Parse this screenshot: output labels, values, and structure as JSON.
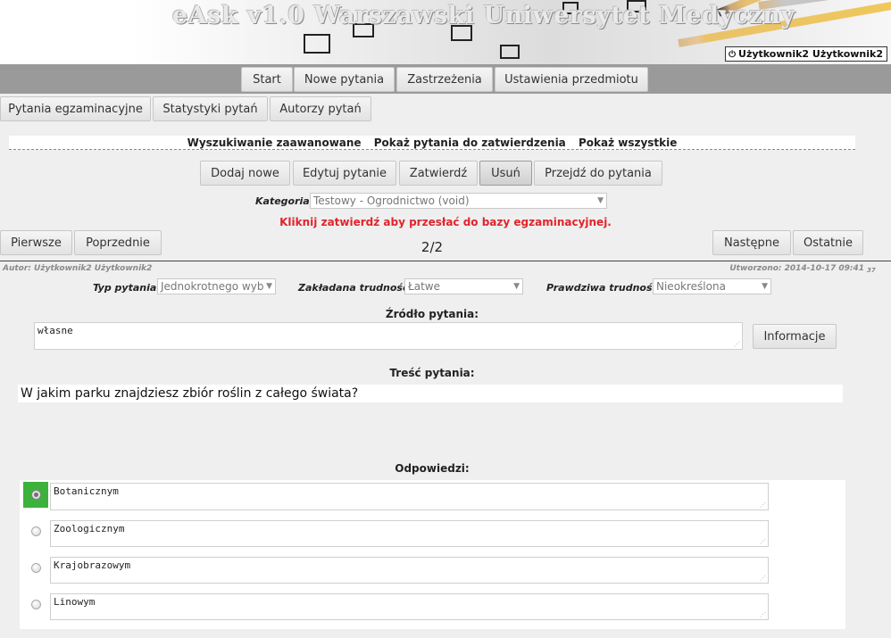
{
  "header": {
    "app_title": "eAsk v1.0 Warszawski Uniwersytet Medyczny",
    "user_label": "Użytkownik2 Użytkownik2",
    "power_icon": "power-icon"
  },
  "main_nav": {
    "start": "Start",
    "new_questions": "Nowe pytania",
    "objections": "Zastrzeżenia",
    "subject_settings": "Ustawienia przedmiotu"
  },
  "sub_nav": {
    "exam_questions": "Pytania egzaminacyjne",
    "question_stats": "Statystyki pytań",
    "question_authors": "Autorzy pytań"
  },
  "search_links": {
    "advanced": "Wyszukiwanie zaawanowane",
    "to_approve": "Pokaż pytania do zatwierdzenia",
    "show_all": "Pokaż wszystkie"
  },
  "toolbar": {
    "add_new": "Dodaj nowe",
    "edit": "Edytuj pytanie",
    "approve": "Zatwierdź",
    "delete": "Usuń",
    "goto": "Przejdź do pytania"
  },
  "category": {
    "label": "Kategoria:",
    "value": "Testowy - Ogrodnictwo (void)"
  },
  "warning": "Kliknij zatwierdź aby przesłać do bazy egzaminacyjnej.",
  "pager": {
    "first": "Pierwsze",
    "previous": "Poprzednie",
    "next": "Następne",
    "last": "Ostatnie",
    "counter": "2/2"
  },
  "meta": {
    "author": "Autor: Użytkownik2 Użytkownik2",
    "created": "Utworzono: 2014-10-17 09:41",
    "created_suffix": "37"
  },
  "fields": {
    "question_type_label": "Typ pytania:",
    "question_type_value": "Jednokrotnego wyb",
    "assumed_difficulty_label": "Zakładana trudność:",
    "assumed_difficulty_value": "Łatwe",
    "real_difficulty_label": "Prawdziwa trudność:",
    "real_difficulty_value": "Nieokreślona"
  },
  "source": {
    "heading": "Źródło pytania:",
    "value": "własne",
    "info_button": "Informacje"
  },
  "content": {
    "heading": "Treść pytania:",
    "value": "W jakim parku znajdziesz zbiór roślin z całego świata?"
  },
  "answers": {
    "heading": "Odpowiedzi:",
    "items": [
      {
        "text": "Botanicznym",
        "selected": true
      },
      {
        "text": "Zoologicznym",
        "selected": false
      },
      {
        "text": "Krajobrazowym",
        "selected": false
      },
      {
        "text": "Linowym",
        "selected": false
      }
    ]
  },
  "colors": {
    "accent_green": "#3cb23c",
    "warning_red": "#e0242b",
    "nav_strip": "#9a9a9a"
  }
}
